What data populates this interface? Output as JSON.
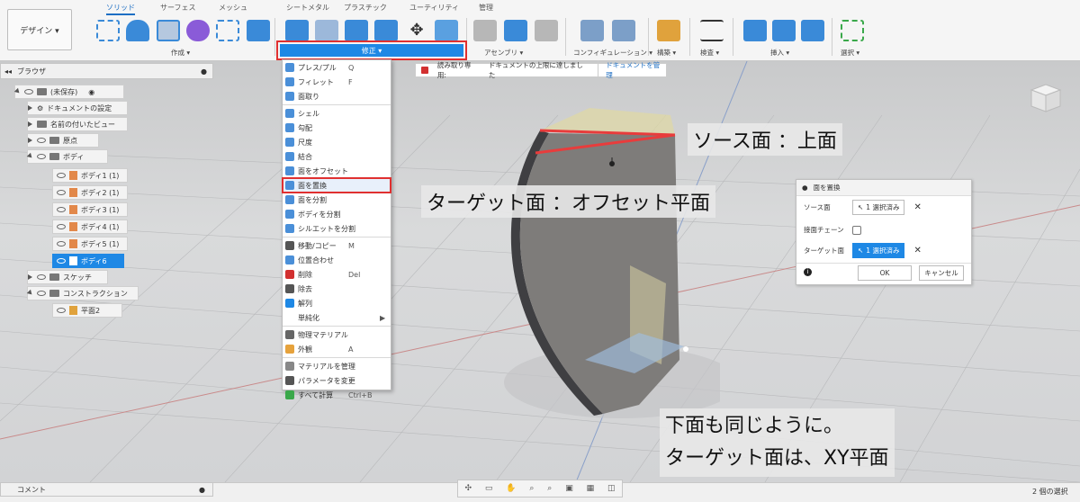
{
  "toolbar": {
    "design_label": "デザイン ▾",
    "tabs": [
      "ソリッド",
      "サーフェス",
      "メッシュ",
      "シートメタル",
      "プラスチック",
      "ユーティリティ",
      "管理"
    ],
    "groups": {
      "create": "作成 ▾",
      "modify": "修正 ▾",
      "assemble": "アセンブリ ▾",
      "configure": "コンフィギュレーション ▾",
      "construct": "構築 ▾",
      "inspect": "検査 ▾",
      "insert": "挿入 ▾",
      "select": "選択 ▾"
    }
  },
  "browser": {
    "title": "ブラウザ",
    "root": "(未保存)",
    "items": [
      {
        "label": "ドキュメントの設定"
      },
      {
        "label": "名前の付いたビュー"
      },
      {
        "label": "原点"
      },
      {
        "label": "ボディ"
      },
      {
        "label": "ボディ1 (1)"
      },
      {
        "label": "ボディ2 (1)"
      },
      {
        "label": "ボディ3 (1)"
      },
      {
        "label": "ボディ4 (1)"
      },
      {
        "label": "ボディ5 (1)"
      },
      {
        "label": "ボディ6"
      },
      {
        "label": "スケッチ"
      },
      {
        "label": "コンストラクション"
      },
      {
        "label": "平面2"
      }
    ]
  },
  "menu": {
    "items": [
      {
        "label": "プレス/プル",
        "key": "Q",
        "color": "#4a8fd8"
      },
      {
        "label": "フィレット",
        "key": "F",
        "color": "#4a8fd8"
      },
      {
        "label": "面取り",
        "key": "",
        "color": "#4a8fd8"
      },
      {
        "label": "シェル",
        "key": "",
        "color": "#4a8fd8"
      },
      {
        "label": "勾配",
        "key": "",
        "color": "#4a8fd8"
      },
      {
        "label": "尺度",
        "key": "",
        "color": "#4a8fd8"
      },
      {
        "label": "結合",
        "key": "",
        "color": "#4a8fd8"
      },
      {
        "label": "面をオフセット",
        "key": "",
        "color": "#4a8fd8"
      },
      {
        "label": "面を置換",
        "key": "",
        "color": "#4a8fd8"
      },
      {
        "label": "面を分割",
        "key": "",
        "color": "#4a8fd8"
      },
      {
        "label": "ボディを分割",
        "key": "",
        "color": "#4a8fd8"
      },
      {
        "label": "シルエットを分割",
        "key": "",
        "color": "#4a8fd8"
      },
      {
        "label": "移動/コピー",
        "key": "M",
        "color": "#555555"
      },
      {
        "label": "位置合わせ",
        "key": "",
        "color": "#4a8fd8"
      },
      {
        "label": "削除",
        "key": "Del",
        "color": "#d23030"
      },
      {
        "label": "除去",
        "key": "",
        "color": "#555555"
      },
      {
        "label": "解列",
        "key": "",
        "color": "#1e88e5"
      },
      {
        "label": "単純化",
        "key": "▶",
        "color": "#ffffff"
      },
      {
        "label": "物理マテリアル",
        "key": "",
        "color": "#666666"
      },
      {
        "label": "外観",
        "key": "A",
        "color": "#e6a23c"
      },
      {
        "label": "マテリアルを管理",
        "key": "",
        "color": "#888888"
      },
      {
        "label": "パラメータを変更",
        "key": "",
        "color": "#555555"
      },
      {
        "label": "すべて計算",
        "key": "Ctrl+B",
        "color": "#3aa84a"
      }
    ]
  },
  "readonly": {
    "label": "読み取り専用:",
    "message": "ドキュメントの上限に達しました",
    "action": "ドキュメントを管理"
  },
  "dialog": {
    "title": "面を置換",
    "source_label": "ソース面",
    "source_value": "1 選択済み",
    "chain_label": "接面チェーン",
    "target_label": "ターゲット面",
    "target_value": "1 選択済み",
    "ok": "OK",
    "cancel": "キャンセル"
  },
  "callouts": {
    "source": "ソース面 ：上面",
    "target": "ターゲット面 ：オフセット平面",
    "bottom_line1": "下面も同じように。",
    "bottom_line2": "ターゲット面は、XY平面"
  },
  "comments": {
    "label": "コメント"
  },
  "status": {
    "selection": "2 個の選択"
  }
}
